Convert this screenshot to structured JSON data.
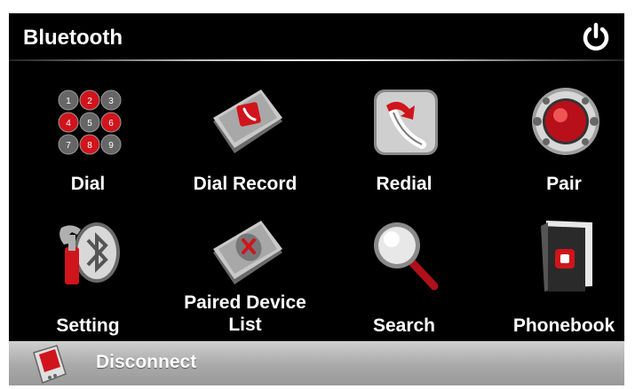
{
  "header": {
    "title": "Bluetooth"
  },
  "menu": [
    {
      "label": "Dial"
    },
    {
      "label": "Dial Record"
    },
    {
      "label": "Redial"
    },
    {
      "label": "Pair"
    },
    {
      "label": "Setting"
    },
    {
      "label": "Paired Device List"
    },
    {
      "label": "Search"
    },
    {
      "label": "Phonebook"
    }
  ],
  "dial_keys": [
    "1",
    "2",
    "3",
    "4",
    "5",
    "6",
    "7",
    "8",
    "9"
  ],
  "footer": {
    "label": "Disconnect"
  },
  "colors": {
    "accent_red": "#d0141c",
    "background": "#000000",
    "bar": "#a9a9a9"
  }
}
